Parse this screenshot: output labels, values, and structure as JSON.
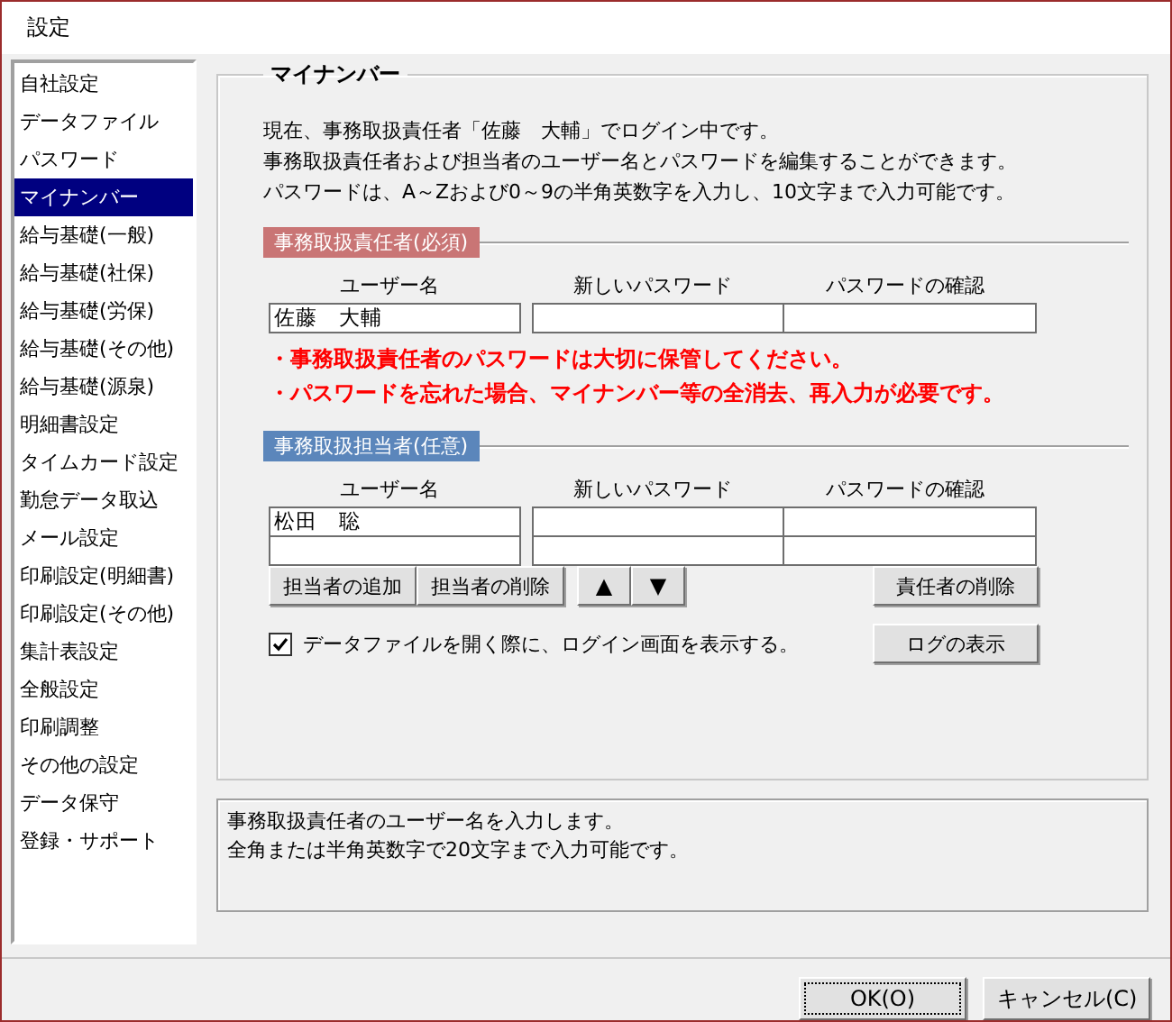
{
  "window": {
    "title": "設定"
  },
  "sidebar": {
    "items": [
      {
        "label": "自社設定",
        "selected": false
      },
      {
        "label": "データファイル",
        "selected": false
      },
      {
        "label": "パスワード",
        "selected": false
      },
      {
        "label": "マイナンバー",
        "selected": true
      },
      {
        "label": "給与基礎(一般)",
        "selected": false
      },
      {
        "label": "給与基礎(社保)",
        "selected": false
      },
      {
        "label": "給与基礎(労保)",
        "selected": false
      },
      {
        "label": "給与基礎(その他)",
        "selected": false
      },
      {
        "label": "給与基礎(源泉)",
        "selected": false
      },
      {
        "label": "明細書設定",
        "selected": false
      },
      {
        "label": "タイムカード設定",
        "selected": false
      },
      {
        "label": "勤怠データ取込",
        "selected": false
      },
      {
        "label": "メール設定",
        "selected": false
      },
      {
        "label": "印刷設定(明細書)",
        "selected": false
      },
      {
        "label": "印刷設定(その他)",
        "selected": false
      },
      {
        "label": "集計表設定",
        "selected": false
      },
      {
        "label": "全般設定",
        "selected": false
      },
      {
        "label": "印刷調整",
        "selected": false
      },
      {
        "label": "その他の設定",
        "selected": false
      },
      {
        "label": "データ保守",
        "selected": false
      },
      {
        "label": "登録・サポート",
        "selected": false
      }
    ]
  },
  "group": {
    "title": "マイナンバー",
    "intro": [
      "現在、事務取扱責任者「佐藤　大輔」でログイン中です。",
      "事務取扱責任者および担当者のユーザー名とパスワードを編集することができます。",
      "パスワードは、A～Zおよび0～9の半角英数字を入力し、10文字まで入力可能です。"
    ],
    "sections": [
      {
        "kind": "required",
        "title": "事務取扱責任者(必須)",
        "columns": [
          "ユーザー名",
          "新しいパスワード",
          "パスワードの確認"
        ],
        "rows": [
          {
            "user_name": "佐藤　大輔"
          }
        ],
        "warnings": [
          "・事務取扱責任者のパスワードは大切に保管してください。",
          "・パスワードを忘れた場合、マイナンバー等の全消去、再入力が必要です。"
        ]
      },
      {
        "kind": "optional",
        "title": "事務取扱担当者(任意)",
        "columns": [
          "ユーザー名",
          "新しいパスワード",
          "パスワードの確認"
        ],
        "rows": [
          {
            "user_name": "松田　聡"
          },
          {}
        ]
      }
    ],
    "staff_buttons": [
      "担当者の追加",
      "担当者の削除"
    ],
    "arrow_buttons": [
      "▲",
      "▼"
    ],
    "delete_manager_button": "責任者の削除",
    "login_checkbox": {
      "label": "データファイルを開く際に、ログイン画面を表示する。",
      "checked": true
    },
    "log_button": "ログの表示"
  },
  "help": {
    "lines": [
      "事務取扱責任者のユーザー名を入力します。",
      "全角または半角英数字で20文字まで入力可能です。"
    ]
  },
  "footer": {
    "buttons": [
      {
        "label": "OK(O)",
        "focused": true
      },
      {
        "label": "キャンセル(C)",
        "focused": false
      }
    ]
  }
}
